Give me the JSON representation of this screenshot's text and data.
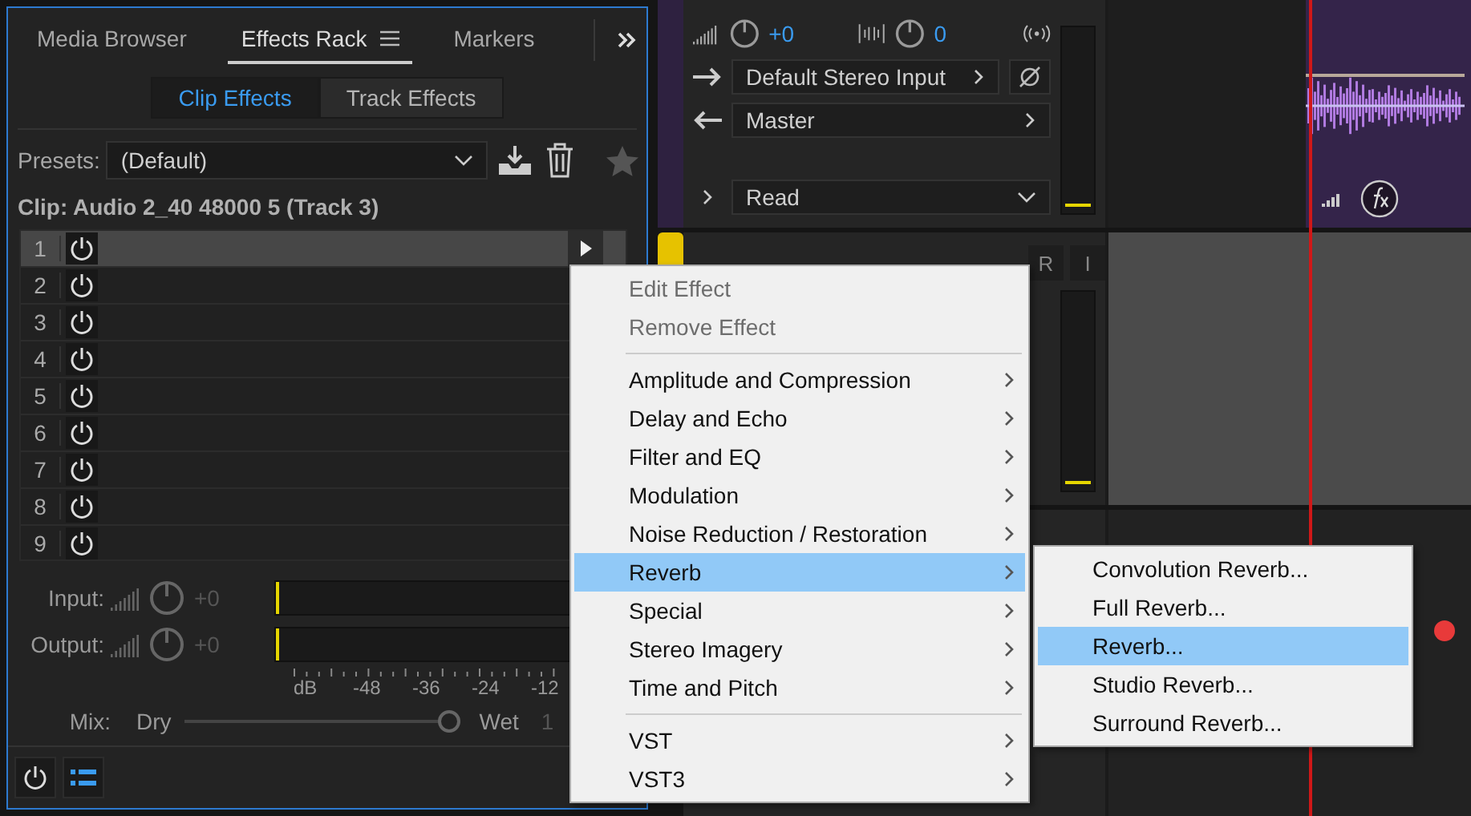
{
  "panel_tabs": [
    {
      "label": "Media Browser",
      "selected": false
    },
    {
      "label": "Effects Rack",
      "selected": true
    },
    {
      "label": "Markers",
      "selected": false
    }
  ],
  "effect_modes": [
    {
      "label": "Clip Effects",
      "selected": true
    },
    {
      "label": "Track Effects",
      "selected": false
    }
  ],
  "presets": {
    "label": "Presets:",
    "value": "(Default)"
  },
  "clip_label": "Clip: Audio 2_40 48000 5 (Track 3)",
  "rack_slots": [
    {
      "number": "1",
      "selected": true
    },
    {
      "number": "2",
      "selected": false
    },
    {
      "number": "3",
      "selected": false
    },
    {
      "number": "4",
      "selected": false
    },
    {
      "number": "5",
      "selected": false
    },
    {
      "number": "6",
      "selected": false
    },
    {
      "number": "7",
      "selected": false
    },
    {
      "number": "8",
      "selected": false
    },
    {
      "number": "9",
      "selected": false
    }
  ],
  "io": [
    {
      "label": "Input:",
      "value": "+0"
    },
    {
      "label": "Output:",
      "value": "+0"
    }
  ],
  "db_scale": [
    "dB",
    "-48",
    "-36",
    "-24",
    "-12"
  ],
  "mix": {
    "label": "Mix:",
    "dry": "Dry",
    "wet": "Wet",
    "value": "1",
    "level": 1
  },
  "mixer": {
    "volume": "+0",
    "pan": "0",
    "input": "Default Stereo Input",
    "output": "Master",
    "automation": "Read"
  },
  "track_3": {
    "color": "#e6c200",
    "buttons": [
      "R",
      "I"
    ]
  },
  "context_menu": [
    {
      "kind": "action",
      "label": "Edit Effect",
      "disabled": true
    },
    {
      "kind": "action",
      "label": "Remove Effect",
      "disabled": true
    },
    {
      "kind": "separator"
    },
    {
      "kind": "submenu",
      "label": "Amplitude and Compression",
      "selected": false
    },
    {
      "kind": "submenu",
      "label": "Delay and Echo",
      "selected": false
    },
    {
      "kind": "submenu",
      "label": "Filter and EQ",
      "selected": false
    },
    {
      "kind": "submenu",
      "label": "Modulation",
      "selected": false
    },
    {
      "kind": "submenu",
      "label": "Noise Reduction / Restoration",
      "selected": false
    },
    {
      "kind": "submenu",
      "label": "Reverb",
      "selected": true
    },
    {
      "kind": "submenu",
      "label": "Special",
      "selected": false
    },
    {
      "kind": "submenu",
      "label": "Stereo Imagery",
      "selected": false
    },
    {
      "kind": "submenu",
      "label": "Time and Pitch",
      "selected": false
    },
    {
      "kind": "separator"
    },
    {
      "kind": "submenu",
      "label": "VST",
      "selected": false
    },
    {
      "kind": "submenu",
      "label": "VST3",
      "selected": false
    }
  ],
  "reverb_submenu": [
    {
      "label": "Convolution Reverb...",
      "selected": false
    },
    {
      "label": "Full Reverb...",
      "selected": false
    },
    {
      "label": "Reverb...",
      "selected": true
    },
    {
      "label": "Studio Reverb...",
      "selected": false
    },
    {
      "label": "Surround Reverb...",
      "selected": false
    }
  ]
}
